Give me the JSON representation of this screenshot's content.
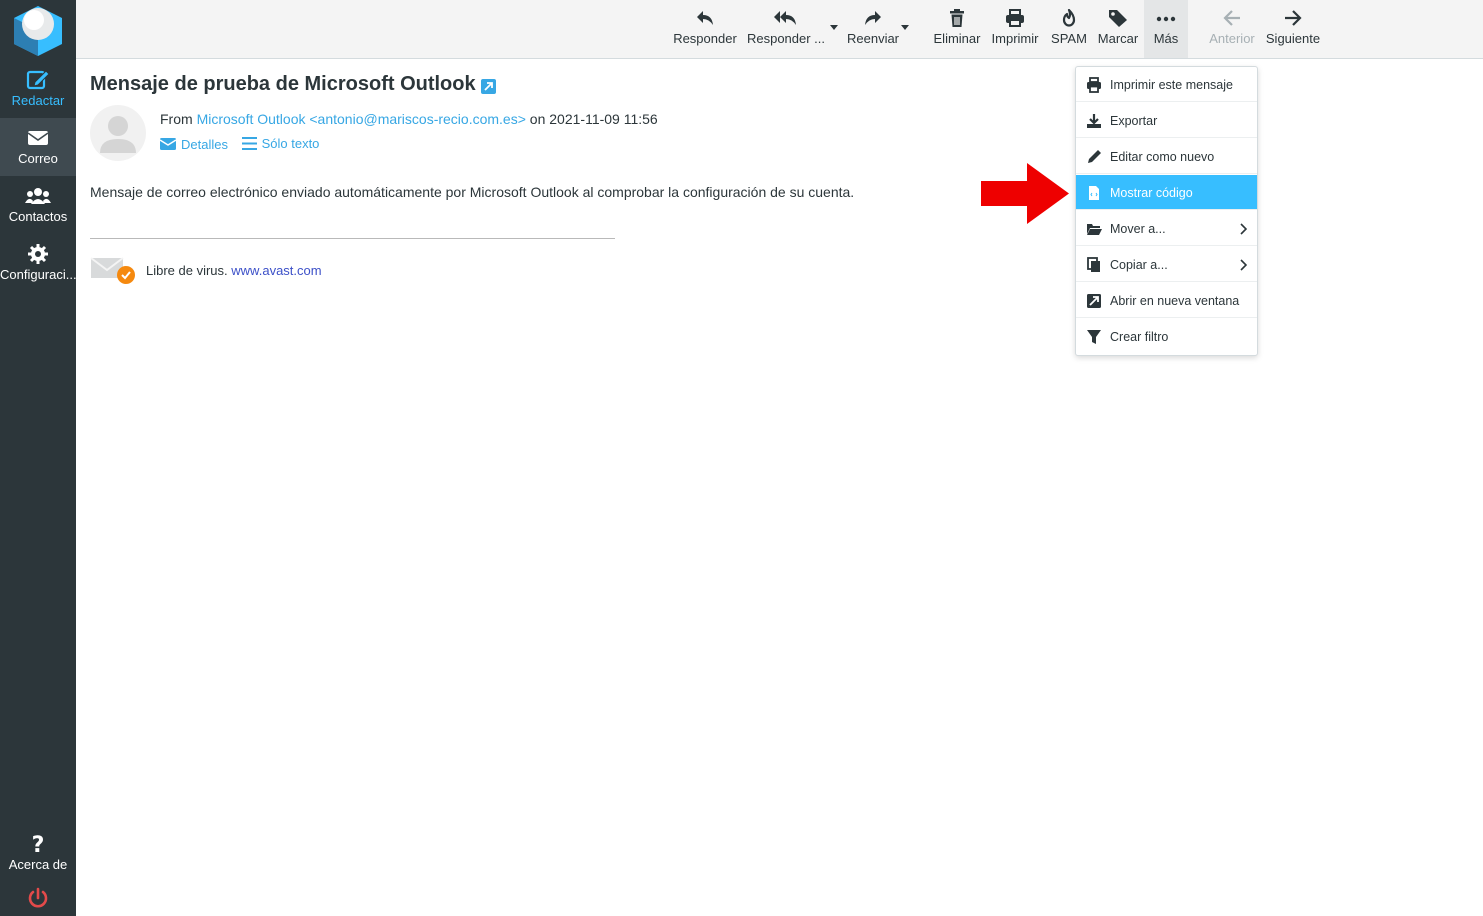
{
  "colors": {
    "sidebar_bg": "#2c363a",
    "accent": "#37beff",
    "link": "#37a7e4",
    "highlight_bg": "#37beff",
    "annotation_arrow": "#ee0000",
    "logout": "#e34a4a"
  },
  "sidebar": {
    "items": [
      {
        "label": "Redactar",
        "icon": "compose-icon",
        "active": false
      },
      {
        "label": "Correo",
        "icon": "envelope-icon",
        "active": true
      },
      {
        "label": "Contactos",
        "icon": "users-icon",
        "active": false
      },
      {
        "label": "Configuraci...",
        "icon": "gear-icon",
        "active": false
      }
    ],
    "about": {
      "label": "Acerca de",
      "icon": "question-icon"
    },
    "logout_icon": "power-icon"
  },
  "toolbar": {
    "buttons": [
      {
        "label": "Responder",
        "icon": "reply-icon"
      },
      {
        "label": "Responder ...",
        "icon": "reply-all-icon"
      },
      {
        "label": "Reenviar",
        "icon": "forward-icon"
      },
      {
        "label": "Eliminar",
        "icon": "trash-icon"
      },
      {
        "label": "Imprimir",
        "icon": "print-icon"
      },
      {
        "label": "SPAM",
        "icon": "fire-icon"
      },
      {
        "label": "Marcar",
        "icon": "tag-icon"
      },
      {
        "label": "Más",
        "icon": "more-icon"
      },
      {
        "label": "Anterior",
        "icon": "arrow-left-icon",
        "disabled": true
      },
      {
        "label": "Siguiente",
        "icon": "arrow-right-icon"
      }
    ]
  },
  "message": {
    "subject": "Mensaje de prueba de Microsoft Outlook",
    "from_prefix": "From",
    "from_name": "Microsoft Outlook <antonio@mariscos-recio.com.es>",
    "date_text": "on 2021-11-09 11:56",
    "details_label": "Detalles",
    "plaintext_label": "Sólo texto",
    "body": "Mensaje de correo electrónico enviado automáticamente por Microsoft Outlook al comprobar la configuración de su cuenta.",
    "signature_text": "Libre de virus.",
    "signature_link": "www.avast.com"
  },
  "more_menu": {
    "items": [
      {
        "label": "Imprimir este mensaje",
        "icon": "print-icon"
      },
      {
        "label": "Exportar",
        "icon": "download-icon"
      },
      {
        "label": "Editar como nuevo",
        "icon": "pencil-icon"
      },
      {
        "label": "Mostrar código",
        "icon": "file-code-icon",
        "highlighted": true
      },
      {
        "label": "Mover a...",
        "icon": "folder-open-icon",
        "submenu": true
      },
      {
        "label": "Copiar a...",
        "icon": "copy-icon",
        "submenu": true
      },
      {
        "label": "Abrir en nueva ventana",
        "icon": "external-link-icon"
      },
      {
        "label": "Crear filtro",
        "icon": "filter-icon"
      }
    ]
  }
}
